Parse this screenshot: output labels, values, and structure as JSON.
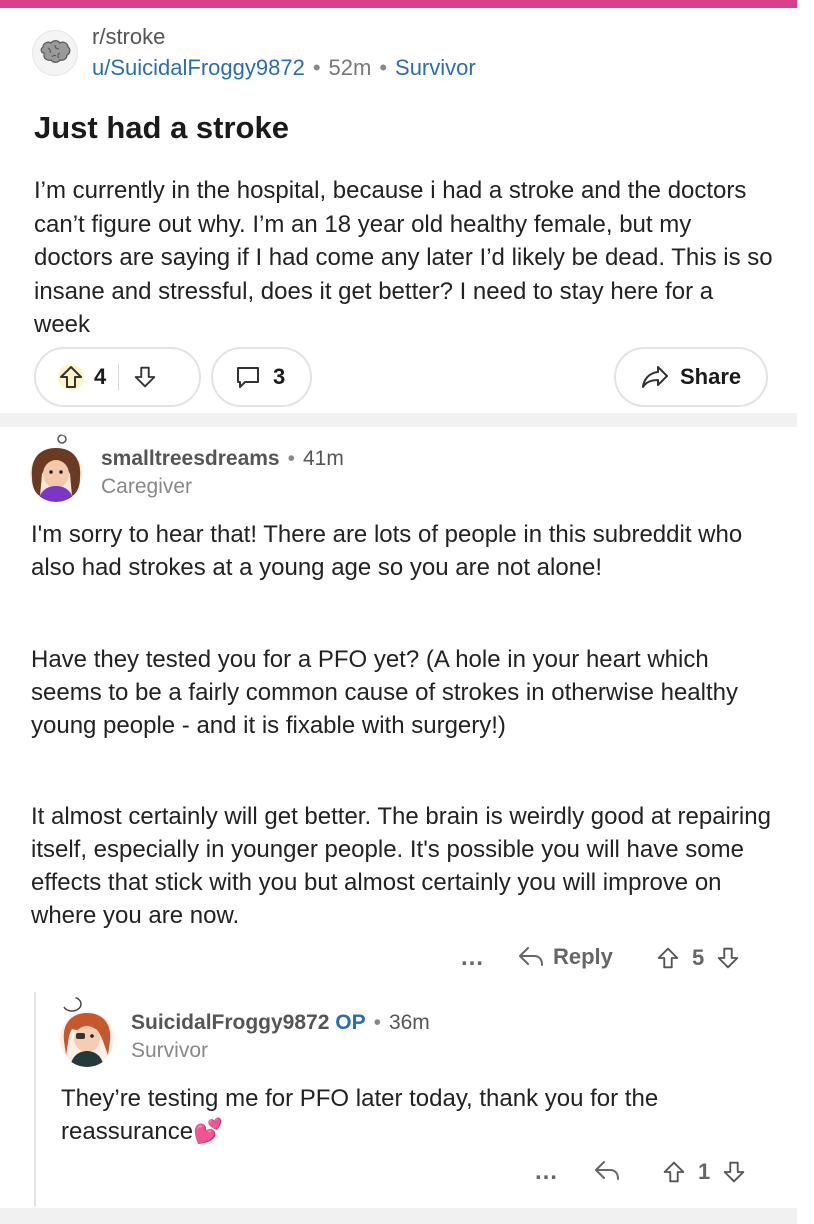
{
  "post": {
    "subreddit": "r/stroke",
    "author": "u/SuicidalFroggy9872",
    "time": "52m",
    "flair": "Survivor",
    "title": "Just had a stroke",
    "body": "I’m currently in the hospital, because i had a stroke and the doctors can’t figure out why. I’m an 18 year old healthy female, but my doctors are saying if I had come any later I’d likely be dead. This is so insane and stressful, does it get better? I need to stay here for a week",
    "upvotes": "4",
    "comments": "3",
    "share_label": "Share",
    "icons": {
      "subreddit": "brain-icon",
      "upvote": "upvote-arrow-icon",
      "downvote": "downvote-arrow-icon",
      "comment": "comment-bubble-icon",
      "share": "share-arrow-icon"
    }
  },
  "comments": [
    {
      "author": "smalltreesdreams",
      "time": "41m",
      "flair": "Caregiver",
      "paragraphs": [
        "I'm sorry to hear that! There are lots of people in this subreddit who also had strokes at a young age so you are not alone!",
        "Have they tested you for a PFO yet? (A hole in your heart which seems to be a fairly common cause of strokes in otherwise healthy young people - and it is fixable with surgery!)",
        "It almost certainly will get better. The brain is weirdly good at repairing itself, especially in younger people. It's possible you will have some effects that stick with you but almost certainly you will improve on where you are now."
      ],
      "more": "…",
      "reply_label": "Reply",
      "votes": "5"
    },
    {
      "author": "SuicidalFroggy9872",
      "op_badge": "OP",
      "time": "36m",
      "flair": "Survivor",
      "text": "They’re testing me for PFO later today, thank you for the reassurance💕",
      "more": "…",
      "votes": "1"
    }
  ],
  "colors": {
    "accent_bar": "#d93f8a",
    "link": "#2a6db5",
    "divider": "#f1f1f1"
  }
}
